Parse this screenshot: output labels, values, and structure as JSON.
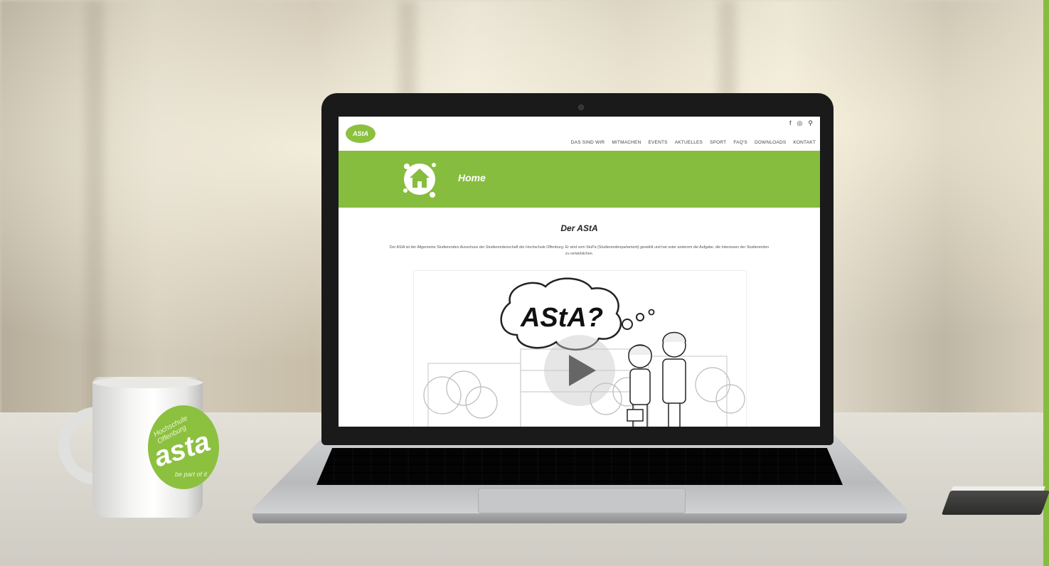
{
  "mug": {
    "line1": "Hochschule Offenburg",
    "logo": "asta",
    "line2": "be part of it"
  },
  "website": {
    "logo_text": "AStA",
    "social_icons": [
      "facebook-icon",
      "instagram-icon",
      "search-icon"
    ],
    "social_glyphs": [
      "f",
      "◎",
      "⚲"
    ],
    "nav": [
      "DAS SIND WIR",
      "MITMACHEN",
      "EVENTS",
      "AKTUELLES",
      "SPORT",
      "FAQ'S",
      "DOWNLOADS",
      "KONTAKT"
    ],
    "banner_title": "Home",
    "section_title": "Der AStA",
    "intro": "Der AStA ist der Allgemeine Studierenden Ausschuss der Studierendenschaft der Hochschule Offenburg. Er wird vom StuPa (Studierendenparlament) gewählt und hat unter anderem die Aufgabe, die Interessen der Studierenden zu verwirklichen.",
    "video_bubble": "AStA?"
  },
  "colors": {
    "brand_green": "#86bd3e",
    "banner_text": "#ffffff"
  }
}
